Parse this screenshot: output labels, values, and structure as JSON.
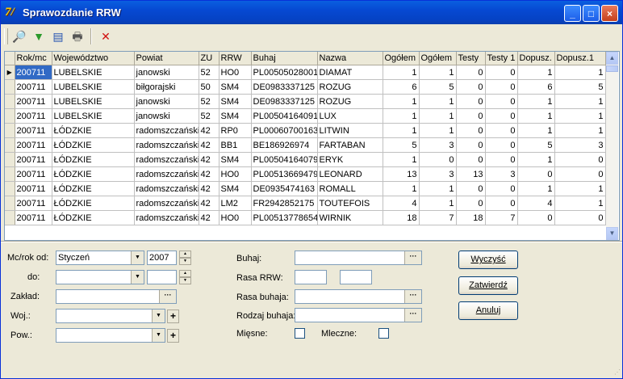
{
  "window": {
    "title": "Sprawozdanie RRW",
    "app_icon_glyph": "7/",
    "controls": {
      "minimize": "_",
      "maximize": "□",
      "close": "×"
    }
  },
  "toolbar": {
    "icons": [
      "search-icon",
      "filter-icon",
      "list-icon",
      "print-icon",
      "close-view-icon"
    ],
    "glyphs": [
      "🔎",
      "▼",
      "▤",
      "🖶",
      "✕"
    ]
  },
  "grid": {
    "columns": [
      "Rok/mc",
      "Województwo",
      "Powiat",
      "ZU",
      "RRW",
      "Buhaj",
      "Nazwa",
      "Ogółem",
      "Ogółem",
      "Testy",
      "Testy 1",
      "Dopusz.",
      "Dopusz.1"
    ],
    "rows": [
      [
        "200711",
        "LUBELSKIE",
        "janowski",
        "52",
        "HO0",
        "PL00505028001",
        "DIAMAT",
        "1",
        "1",
        "0",
        "0",
        "1",
        "1"
      ],
      [
        "200711",
        "LUBELSKIE",
        "biłgorajski",
        "50",
        "SM4",
        "DE0983337125",
        "ROZUG",
        "6",
        "5",
        "0",
        "0",
        "6",
        "5"
      ],
      [
        "200711",
        "LUBELSKIE",
        "janowski",
        "52",
        "SM4",
        "DE0983337125",
        "ROZUG",
        "1",
        "1",
        "0",
        "0",
        "1",
        "1"
      ],
      [
        "200711",
        "LUBELSKIE",
        "janowski",
        "52",
        "SM4",
        "PL00504164091",
        "LUX",
        "1",
        "1",
        "0",
        "0",
        "1",
        "1"
      ],
      [
        "200711",
        "ŁÓDZKIE",
        "radomszczański",
        "42",
        "RP0",
        "PL00060700163",
        "LITWIN",
        "1",
        "1",
        "0",
        "0",
        "1",
        "1"
      ],
      [
        "200711",
        "ŁÓDZKIE",
        "radomszczański",
        "42",
        "BB1",
        "BE186926974",
        "FARTABAN",
        "5",
        "3",
        "0",
        "0",
        "5",
        "3"
      ],
      [
        "200711",
        "ŁÓDZKIE",
        "radomszczański",
        "42",
        "SM4",
        "PL00504164079",
        "ERYK",
        "1",
        "0",
        "0",
        "0",
        "1",
        "0"
      ],
      [
        "200711",
        "ŁÓDZKIE",
        "radomszczański",
        "42",
        "HO0",
        "PL00513669479",
        "LEONARD",
        "13",
        "3",
        "13",
        "3",
        "0",
        "0"
      ],
      [
        "200711",
        "ŁÓDZKIE",
        "radomszczański",
        "42",
        "SM4",
        "DE0935474163",
        "ROMALL",
        "1",
        "1",
        "0",
        "0",
        "1",
        "1"
      ],
      [
        "200711",
        "ŁÓDZKIE",
        "radomszczański",
        "42",
        "LM2",
        "FR2942852175",
        "TOUTEFOIS",
        "4",
        "1",
        "0",
        "0",
        "4",
        "1"
      ],
      [
        "200711",
        "ŁÓDZKIE",
        "radomszczański",
        "42",
        "HO0",
        "PL00513778654",
        "WIRNIK",
        "18",
        "7",
        "18",
        "7",
        "0",
        "0"
      ]
    ]
  },
  "form": {
    "mcrok_od_label": "Mc/rok od:",
    "month_from": "Styczeń",
    "year_from": "2007",
    "do_label": "do:",
    "month_to": "",
    "year_to": "",
    "zaklad_label": "Zakład:",
    "woj_label": "Woj.:",
    "pow_label": "Pow.:",
    "buhaj_label": "Buhaj:",
    "rasa_rrw_label": "Rasa RRW:",
    "rasa_buhaja_label": "Rasa buhaja:",
    "rodzaj_buhaja_label": "Rodzaj buhaja:",
    "miesne_label": "Mięsne:",
    "mleczne_label": "Mleczne:",
    "dots": "···",
    "plus": "+"
  },
  "buttons": {
    "clear": "Wyczyść",
    "confirm": "Zatwierdź",
    "cancel": "Anuluj"
  }
}
